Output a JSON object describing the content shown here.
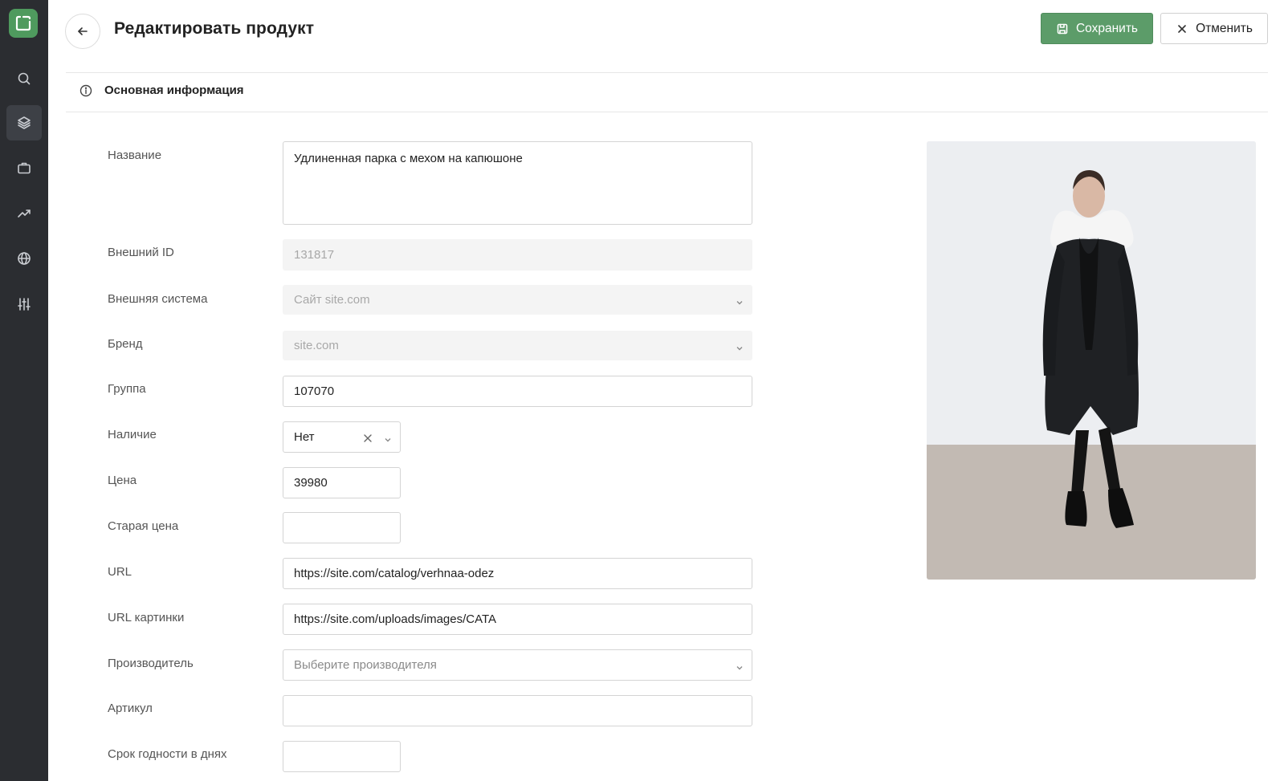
{
  "header": {
    "title": "Редактировать продукт",
    "save_label": "Сохранить",
    "cancel_label": "Отменить"
  },
  "sidebar": {
    "items": [
      {
        "icon": "search-icon"
      },
      {
        "icon": "layers-icon",
        "active": true
      },
      {
        "icon": "briefcase-icon"
      },
      {
        "icon": "trend-icon"
      },
      {
        "icon": "globe-icon"
      },
      {
        "icon": "sliders-icon"
      }
    ]
  },
  "section": {
    "title": "Основная информация"
  },
  "form": {
    "name": {
      "label": "Название",
      "value": "Удлиненная парка с мехом на капюшоне"
    },
    "external_id": {
      "label": "Внешний ID",
      "value": "131817"
    },
    "external_system": {
      "label": "Внешняя система",
      "value": "Сайт site.com"
    },
    "brand": {
      "label": "Бренд",
      "value": "site.com"
    },
    "group": {
      "label": "Группа",
      "value": "107070"
    },
    "availability": {
      "label": "Наличие",
      "value": "Нет"
    },
    "price": {
      "label": "Цена",
      "value": "39980"
    },
    "old_price": {
      "label": "Старая цена",
      "value": ""
    },
    "url": {
      "label": "URL",
      "value": "https://site.com/catalog/verhnaa-odez"
    },
    "image_url": {
      "label": "URL картинки",
      "value": "https://site.com/uploads/images/CATA"
    },
    "manufacturer": {
      "label": "Производитель",
      "placeholder": "Выберите производителя"
    },
    "sku": {
      "label": "Артикул",
      "value": ""
    },
    "shelf_life": {
      "label": "Срок годности в днях",
      "value": ""
    }
  },
  "colors": {
    "sidebar_bg": "#2b2d31",
    "accent": "#5c9c69"
  }
}
